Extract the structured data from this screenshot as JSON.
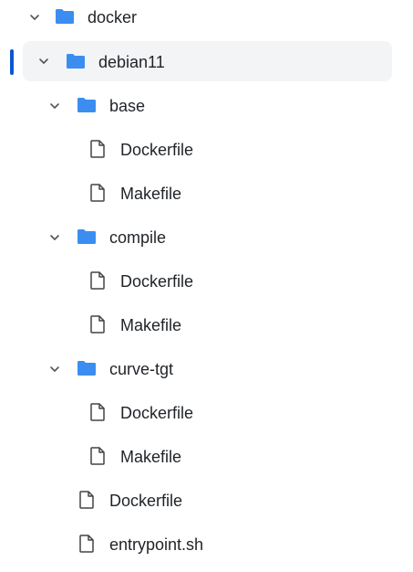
{
  "colors": {
    "folder": "#3b8ef0",
    "accent": "#0b57d0",
    "selected_bg": "#f3f4f6",
    "text": "#1f2328",
    "icon_stroke": "#444444"
  },
  "tree": {
    "items": [
      {
        "label": "docker",
        "type": "folder",
        "expanded": true
      },
      {
        "label": "debian11",
        "type": "folder",
        "expanded": true,
        "selected": true
      },
      {
        "label": "base",
        "type": "folder",
        "expanded": true
      },
      {
        "label": "Dockerfile",
        "type": "file"
      },
      {
        "label": "Makefile",
        "type": "file"
      },
      {
        "label": "compile",
        "type": "folder",
        "expanded": true
      },
      {
        "label": "Dockerfile",
        "type": "file"
      },
      {
        "label": "Makefile",
        "type": "file"
      },
      {
        "label": "curve-tgt",
        "type": "folder",
        "expanded": true
      },
      {
        "label": "Dockerfile",
        "type": "file"
      },
      {
        "label": "Makefile",
        "type": "file"
      },
      {
        "label": "Dockerfile",
        "type": "file"
      },
      {
        "label": "entrypoint.sh",
        "type": "file"
      }
    ]
  }
}
